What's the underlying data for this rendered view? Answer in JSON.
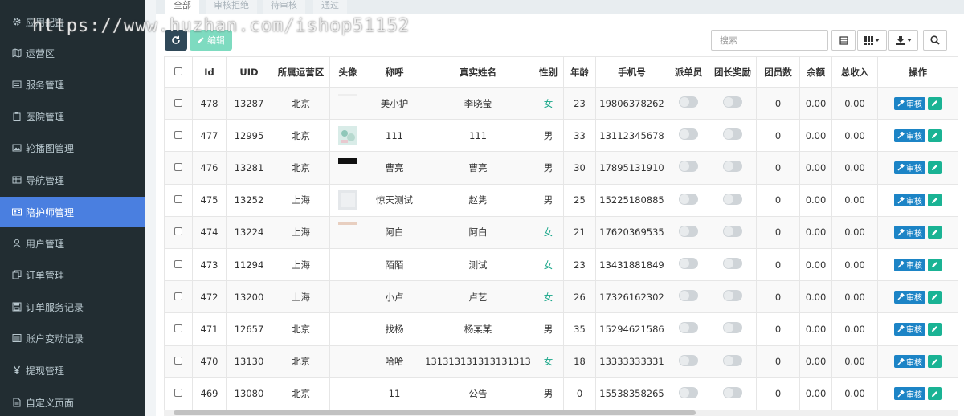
{
  "watermark": "https://www.huzhan.com/ishop51152",
  "sidebar": {
    "items": [
      {
        "label": "应用配置",
        "icon": "gear-icon"
      },
      {
        "label": "运营区",
        "icon": "map-icon"
      },
      {
        "label": "服务管理",
        "icon": "list-icon"
      },
      {
        "label": "医院管理",
        "icon": "clipboard-icon"
      },
      {
        "label": "轮播图管理",
        "icon": "image-icon"
      },
      {
        "label": "导航管理",
        "icon": "table-icon"
      },
      {
        "label": "陪护师管理",
        "icon": "id-card-icon",
        "active": true
      },
      {
        "label": "用户管理",
        "icon": "user-icon"
      },
      {
        "label": "订单管理",
        "icon": "copy-icon"
      },
      {
        "label": "订单服务记录",
        "icon": "save-icon"
      },
      {
        "label": "账户变动记录",
        "icon": "list-alt-icon"
      },
      {
        "label": "提现管理",
        "icon": "yen-icon"
      },
      {
        "label": "自定义页面",
        "icon": "file-icon"
      }
    ]
  },
  "tabs": [
    "全部",
    "审核拒绝",
    "待审核",
    "通过"
  ],
  "toolbar": {
    "edit_label": "编辑",
    "search_placeholder": "搜索"
  },
  "table": {
    "headers": [
      "Id",
      "UID",
      "所属运营区",
      "头像",
      "称呼",
      "真实姓名",
      "性别",
      "年龄",
      "手机号",
      "派单员",
      "团长奖励",
      "团员数",
      "余额",
      "总收入",
      "操作"
    ],
    "audit_label": "审核",
    "rows": [
      {
        "id": "478",
        "uid": "13287",
        "region": "北京",
        "avatar": "faint",
        "nickname": "美小护",
        "realname": "李晓莹",
        "gender": "女",
        "age": "23",
        "phone": "19806378262",
        "members": "0",
        "balance": "0.00",
        "income": "0.00"
      },
      {
        "id": "477",
        "uid": "12995",
        "region": "北京",
        "avatar": "photo",
        "nickname": "111",
        "realname": "111",
        "gender": "男",
        "age": "33",
        "phone": "13112345678",
        "members": "0",
        "balance": "0.00",
        "income": "0.00"
      },
      {
        "id": "476",
        "uid": "13281",
        "region": "北京",
        "avatar": "dark",
        "nickname": "曹亮",
        "realname": "曹亮",
        "gender": "男",
        "age": "30",
        "phone": "17895131910",
        "members": "0",
        "balance": "0.00",
        "income": "0.00"
      },
      {
        "id": "475",
        "uid": "13252",
        "region": "上海",
        "avatar": "light",
        "nickname": "惊天测试",
        "realname": "赵隽",
        "gender": "男",
        "age": "25",
        "phone": "15225180885",
        "members": "0",
        "balance": "0.00",
        "income": "0.00"
      },
      {
        "id": "474",
        "uid": "13224",
        "region": "上海",
        "avatar": "strip",
        "nickname": "阿白",
        "realname": "阿白",
        "gender": "女",
        "age": "21",
        "phone": "17620369535",
        "members": "0",
        "balance": "0.00",
        "income": "0.00"
      },
      {
        "id": "473",
        "uid": "11294",
        "region": "上海",
        "avatar": "none",
        "nickname": "陌陌",
        "realname": "测试",
        "gender": "女",
        "age": "23",
        "phone": "13431881849",
        "members": "0",
        "balance": "0.00",
        "income": "0.00"
      },
      {
        "id": "472",
        "uid": "13200",
        "region": "上海",
        "avatar": "none",
        "nickname": "小卢",
        "realname": "卢艺",
        "gender": "女",
        "age": "26",
        "phone": "17326162302",
        "members": "0",
        "balance": "0.00",
        "income": "0.00"
      },
      {
        "id": "471",
        "uid": "12657",
        "region": "北京",
        "avatar": "none",
        "nickname": "找杨",
        "realname": "杨某某",
        "gender": "男",
        "age": "35",
        "phone": "15294621586",
        "members": "0",
        "balance": "0.00",
        "income": "0.00"
      },
      {
        "id": "470",
        "uid": "13130",
        "region": "北京",
        "avatar": "none",
        "nickname": "哈哈",
        "realname": "131313131313131313",
        "gender": "女",
        "age": "18",
        "phone": "13333333331",
        "members": "0",
        "balance": "0.00",
        "income": "0.00"
      },
      {
        "id": "469",
        "uid": "13080",
        "region": "北京",
        "avatar": "none",
        "nickname": "11",
        "realname": "公告",
        "gender": "男",
        "age": "0",
        "phone": "15538358265",
        "members": "0",
        "balance": "0.00",
        "income": "0.00"
      }
    ]
  }
}
